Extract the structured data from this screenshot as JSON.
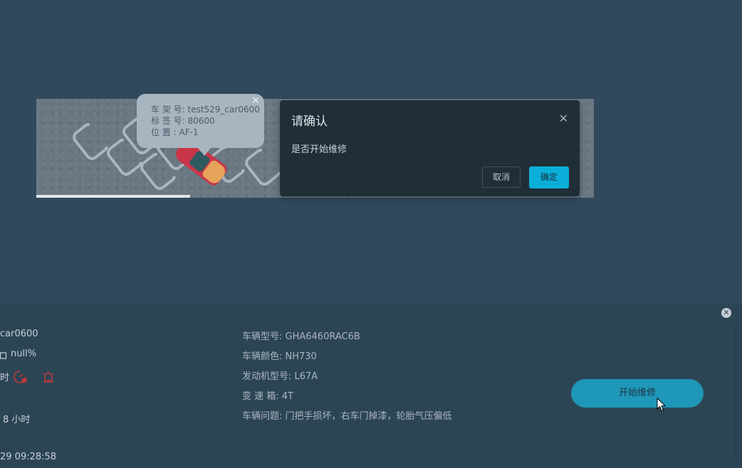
{
  "map": {
    "tooltip": {
      "frame_line": "车 架 号: test529_car0600",
      "tag_line": "标 签 号: 80600",
      "position_line": "位 置 : AF-1",
      "close_glyph": "✕"
    }
  },
  "dialog": {
    "title": "请确认",
    "message": "是否开始维修",
    "cancel_label": "取消",
    "confirm_label": "确定",
    "close_glyph": "✕"
  },
  "panel": {
    "close_glyph": "✕",
    "left": {
      "car_id_partial": "car0600",
      "battery_text": "null%",
      "hour_partial": "时",
      "duration_text": "8 小时",
      "datetime_partial": "29 09:28:58"
    },
    "details": {
      "model": "车辆型号: GHA6460RAC6B",
      "color": "车辆颜色: NH730",
      "engine": "发动机型号: L67A",
      "gearbox": "变 速 箱: 4T",
      "issue": "车辆问题: 门把手损坏，右车门掉漆，轮胎气压偏低"
    },
    "start_repair_label": "开始维修",
    "icons": [
      "battery-icon",
      "speed-alert-icon",
      "alarm-light-icon"
    ]
  },
  "colors": {
    "background": "#31495c",
    "dialog_bg": "#1f2e37",
    "confirm_accent": "#0aaed8",
    "start_button": "#1e97b8",
    "alert_red": "#c0393c"
  }
}
